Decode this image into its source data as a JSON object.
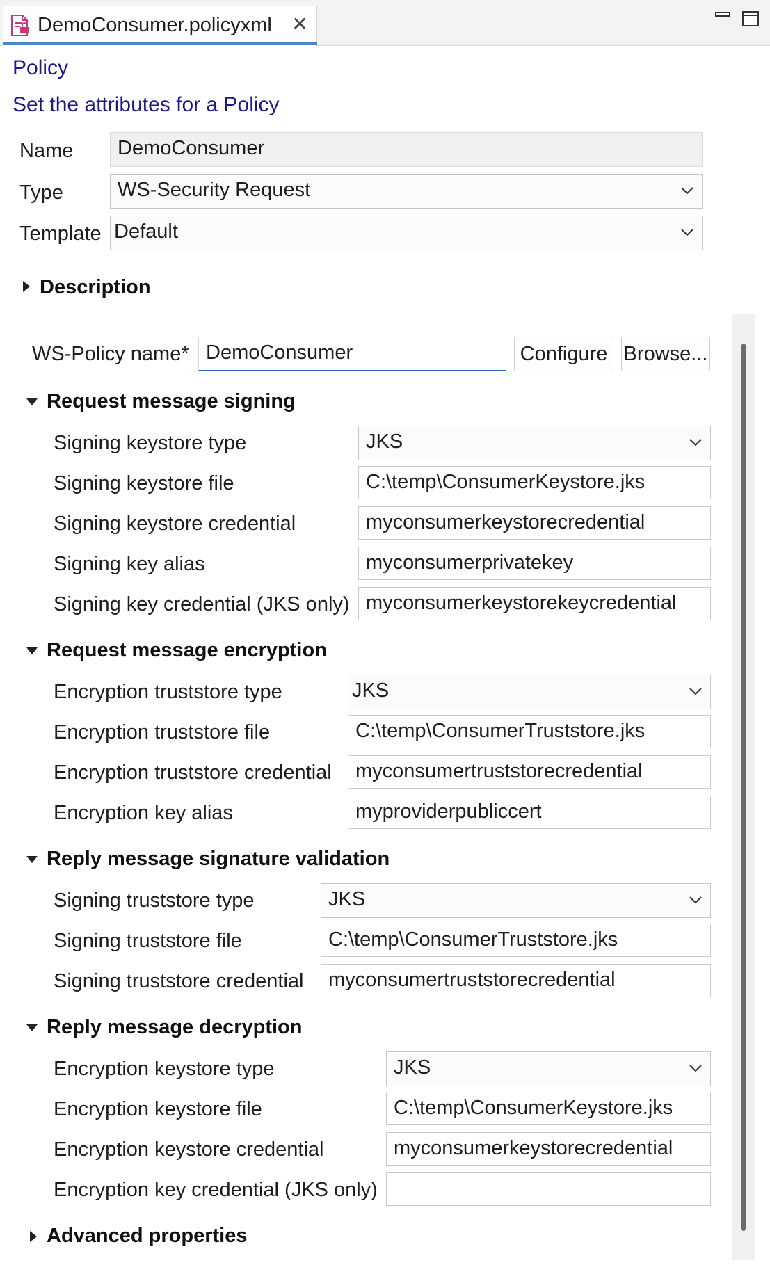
{
  "tab": {
    "title": "DemoConsumer.policyxml",
    "close_glyph": "✕"
  },
  "header": {
    "title": "Policy",
    "subtitle": "Set the attributes for a Policy"
  },
  "form": {
    "name_label": "Name",
    "name_value": "DemoConsumer",
    "type_label": "Type",
    "type_value": "WS-Security Request",
    "template_label": "Template",
    "template_value": "Default"
  },
  "description_label": "Description",
  "wspolicy": {
    "label": "WS-Policy name*",
    "value": "DemoConsumer",
    "configure_label": "Configure",
    "browse_label": "Browse..."
  },
  "sections": {
    "req_sign": {
      "title": "Request message signing",
      "keystore_type_label": "Signing keystore type",
      "keystore_type_value": "JKS",
      "keystore_file_label": "Signing keystore file",
      "keystore_file_value": "C:\\temp\\ConsumerKeystore.jks",
      "keystore_cred_label": "Signing keystore credential",
      "keystore_cred_value": "myconsumerkeystorecredential",
      "key_alias_label": "Signing key alias",
      "key_alias_value": "myconsumerprivatekey",
      "key_cred_label": "Signing key credential (JKS only)",
      "key_cred_value": "myconsumerkeystorekeycredential"
    },
    "req_enc": {
      "title": "Request message encryption",
      "truststore_type_label": "Encryption truststore type",
      "truststore_type_value": "JKS",
      "truststore_file_label": "Encryption truststore file",
      "truststore_file_value": "C:\\temp\\ConsumerTruststore.jks",
      "truststore_cred_label": "Encryption truststore credential",
      "truststore_cred_value": "myconsumertruststorecredential",
      "key_alias_label": "Encryption key alias",
      "key_alias_value": "myproviderpubliccert"
    },
    "rep_sig": {
      "title": "Reply message signature validation",
      "truststore_type_label": "Signing truststore type",
      "truststore_type_value": "JKS",
      "truststore_file_label": "Signing truststore file",
      "truststore_file_value": "C:\\temp\\ConsumerTruststore.jks",
      "truststore_cred_label": "Signing truststore credential",
      "truststore_cred_value": "myconsumertruststorecredential"
    },
    "rep_dec": {
      "title": "Reply message decryption",
      "keystore_type_label": "Encryption keystore type",
      "keystore_type_value": "JKS",
      "keystore_file_label": "Encryption keystore file",
      "keystore_file_value": "C:\\temp\\ConsumerKeystore.jks",
      "keystore_cred_label": "Encryption keystore credential",
      "keystore_cred_value": "myconsumerkeystorecredential",
      "key_cred_label": "Encryption key credential (JKS only)",
      "key_cred_value": ""
    }
  },
  "advanced_label": "Advanced properties",
  "colors": {
    "header_blue": "#1a1a8c",
    "tab_accent": "#4a86c8",
    "focus_blue": "#2f65c8",
    "icon_pink": "#d0347a"
  }
}
